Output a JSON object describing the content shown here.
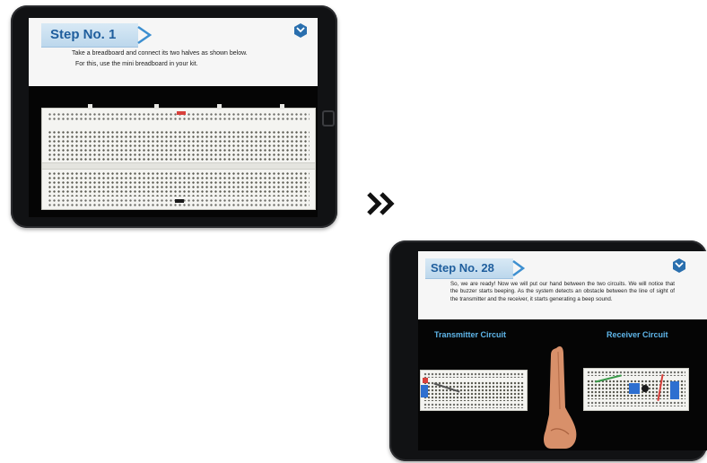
{
  "step1": {
    "title": "Step No. 1",
    "description_line1": "Take a breadboard and connect its two halves as shown below.",
    "description_line2": "For this, use the mini breadboard in your kit."
  },
  "step28": {
    "title": "Step No. 28",
    "description": "So, we are ready! Now we will put our hand between the two circuits. We will notice that the buzzer starts beeping. As the system detects an obstacle between the line of sight of the transmitter and the receiver, it starts generating a beep sound.",
    "transmitter_label": "Transmitter Circuit",
    "receiver_label": "Receiver Circuit"
  },
  "icons": {
    "next_arrow": "double-chevron-right-icon",
    "logo": "cube-logo-icon",
    "step_chevron": "chevron-right-icon"
  },
  "colors": {
    "accent_blue": "#1f5e9d",
    "label_blue": "#5fb6ea",
    "tablet_bezel": "#111214"
  }
}
